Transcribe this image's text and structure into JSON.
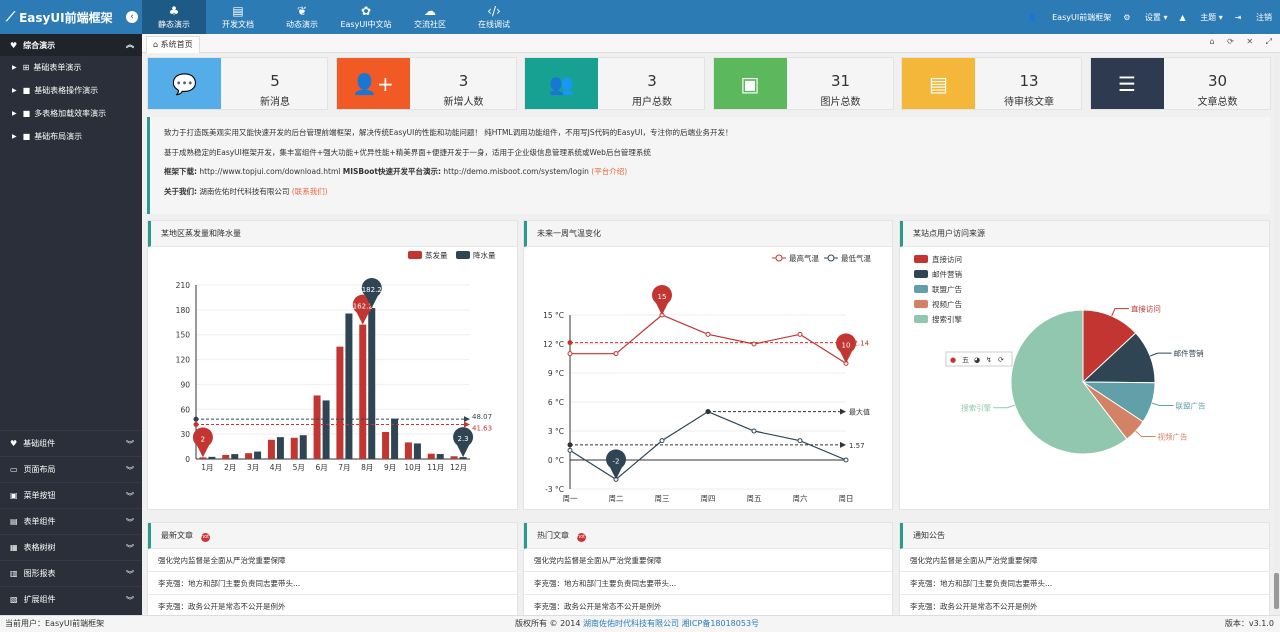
{
  "app": {
    "title": "EasyUI前端框架"
  },
  "topnav": [
    {
      "label": "静态演示",
      "icon": "tree-icon"
    },
    {
      "label": "开发文档",
      "icon": "book-icon"
    },
    {
      "label": "动态演示",
      "icon": "leaf-icon"
    },
    {
      "label": "EasyUI中文站",
      "icon": "sprout-icon"
    },
    {
      "label": "交流社区",
      "icon": "wechat-icon"
    },
    {
      "label": "在线调试",
      "icon": "code-icon"
    }
  ],
  "user_menu": {
    "user": "EasyUI前端框架",
    "settings": "设置",
    "theme": "主题",
    "logout": "注销"
  },
  "sidebar": {
    "header": "综合演示",
    "items": [
      "基础表单演示",
      "基础表格操作演示",
      "多表格加载效率演示",
      "基础布局演示"
    ],
    "groups": [
      "基础组件",
      "页面布局",
      "菜单按钮",
      "表单组件",
      "表格树树",
      "图形报表",
      "扩展组件"
    ]
  },
  "tabs": {
    "home": "系统首页"
  },
  "stats": [
    {
      "value": "5",
      "label": "新消息",
      "color": "#54ade8",
      "icon": "chat-icon"
    },
    {
      "value": "3",
      "label": "新增人数",
      "color": "#f15a24",
      "icon": "add-user-icon"
    },
    {
      "value": "3",
      "label": "用户总数",
      "color": "#17a193",
      "icon": "users-icon"
    },
    {
      "value": "31",
      "label": "图片总数",
      "color": "#5cb85c",
      "icon": "image-icon"
    },
    {
      "value": "13",
      "label": "待审核文章",
      "color": "#f4b73a",
      "icon": "document-icon"
    },
    {
      "value": "30",
      "label": "文章总数",
      "color": "#2d3a4f",
      "icon": "articles-icon"
    }
  ],
  "intro": {
    "line1": "致力于打造既美观实用又能快速开发的后台管理前端框架，解决传统EasyUI的性能和功能问题！ 纯HTML调用功能组件，不用写JS代码的EasyUI，专注你的后端业务开发！",
    "line2": "基于成熟稳定的EasyUI框架开发，集丰富组件+强大功能+优异性能+精美界面+便捷开发于一身，适用于企业级信息管理系统或Web后台管理系统",
    "download_label": "框架下载:",
    "download_url": "http://www.topjui.com/download.html",
    "demo_label": "MISBoot快速开发平台演示:",
    "demo_url": "http://demo.misboot.com/system/login",
    "demo_link": "(平台介绍)",
    "about_label": "关于我们:",
    "about_company": "湖南佐佑时代科技有限公司",
    "about_link": "(联系我们)"
  },
  "panels": {
    "bar_title": "某地区蒸发量和降水量",
    "line_title": "未来一周气温变化",
    "pie_title": "某站点用户访问来源",
    "latest_title": "最新文章",
    "hot_title": "热门文章",
    "notice_title": "通知公告"
  },
  "news": [
    "强化党内监督是全面从严治党重要保障",
    "李克强：地方和部门主要负责同志要带头...",
    "李克强：政务公开是常态不公开是例外"
  ],
  "hot_badge": "hot",
  "footer": {
    "current_user": "当前用户：EasyUI前端框架",
    "copyright": "版权所有 © 2014",
    "company": "湖南佐佑时代科技有限公司",
    "icp": "湘ICP备18018053号",
    "version": "版本：v3.1.0"
  },
  "chart_data": [
    {
      "type": "bar",
      "title": "某地区蒸发量和降水量",
      "categories": [
        "1月",
        "2月",
        "3月",
        "4月",
        "5月",
        "6月",
        "7月",
        "8月",
        "9月",
        "10月",
        "11月",
        "12月"
      ],
      "series": [
        {
          "name": "蒸发量",
          "color": "#c23531",
          "values": [
            2.0,
            4.9,
            7.0,
            23.2,
            25.6,
            76.7,
            135.6,
            162.2,
            32.6,
            20.0,
            6.4,
            3.3
          ]
        },
        {
          "name": "降水量",
          "color": "#2f4554",
          "values": [
            2.6,
            5.9,
            9.0,
            26.4,
            28.7,
            70.7,
            175.6,
            182.2,
            48.7,
            18.8,
            6.0,
            2.3
          ]
        }
      ],
      "ylim": [
        0,
        210
      ],
      "yticks": [
        0,
        30,
        60,
        90,
        120,
        150,
        180,
        210
      ],
      "markPoints": [
        {
          "label": "2",
          "series": 0,
          "index": 0
        },
        {
          "label": "162.2",
          "series": 0,
          "index": 7
        },
        {
          "label": "182.2",
          "series": 1,
          "index": 7
        },
        {
          "label": "2.3",
          "series": 1,
          "index": 11
        }
      ],
      "markLines": [
        {
          "label": "48.07",
          "value": 48.07,
          "series": 1
        },
        {
          "label": "41.63",
          "value": 41.63,
          "series": 0
        }
      ],
      "legend": "top-right"
    },
    {
      "type": "line",
      "title": "未来一周气温变化",
      "categories": [
        "周一",
        "周二",
        "周三",
        "周四",
        "周五",
        "周六",
        "周日"
      ],
      "series": [
        {
          "name": "最高气温",
          "color": "#c23531",
          "values": [
            11,
            11,
            15,
            13,
            12,
            13,
            10
          ]
        },
        {
          "name": "最低气温",
          "color": "#2f4554",
          "values": [
            1,
            -2,
            2,
            5,
            3,
            2,
            0
          ]
        }
      ],
      "ylim": [
        -3,
        15
      ],
      "yticks": [
        -3,
        0,
        3,
        6,
        9,
        12,
        15
      ],
      "ytick_labels": [
        "-3 °C",
        "0 °C",
        "3 °C",
        "6 °C",
        "9 °C",
        "12 °C",
        "15 °C"
      ],
      "markPoints": [
        {
          "label": "15",
          "series": 0,
          "index": 2
        },
        {
          "label": "10",
          "series": 0,
          "index": 6
        },
        {
          "label": "-2",
          "series": 1,
          "index": 1
        }
      ],
      "markLines": [
        {
          "label": "12.14",
          "value": 12.14,
          "series": 0
        },
        {
          "label": "最大值",
          "value": 5,
          "series": 1
        },
        {
          "label": "1.57",
          "value": 1.57,
          "series": 1
        }
      ],
      "legend": "top-right"
    },
    {
      "type": "pie",
      "title": "某站点用户访问来源",
      "labels": [
        "直接访问",
        "邮件营销",
        "联盟广告",
        "视频广告",
        "搜索引擎"
      ],
      "values": [
        335,
        310,
        234,
        135,
        1548
      ],
      "colors": [
        "#c23531",
        "#2f4554",
        "#61a0a8",
        "#d48265",
        "#91c7ae"
      ],
      "legend": "top-left",
      "toolbox": [
        "五",
        "◕",
        "↯",
        "⟳"
      ]
    }
  ]
}
